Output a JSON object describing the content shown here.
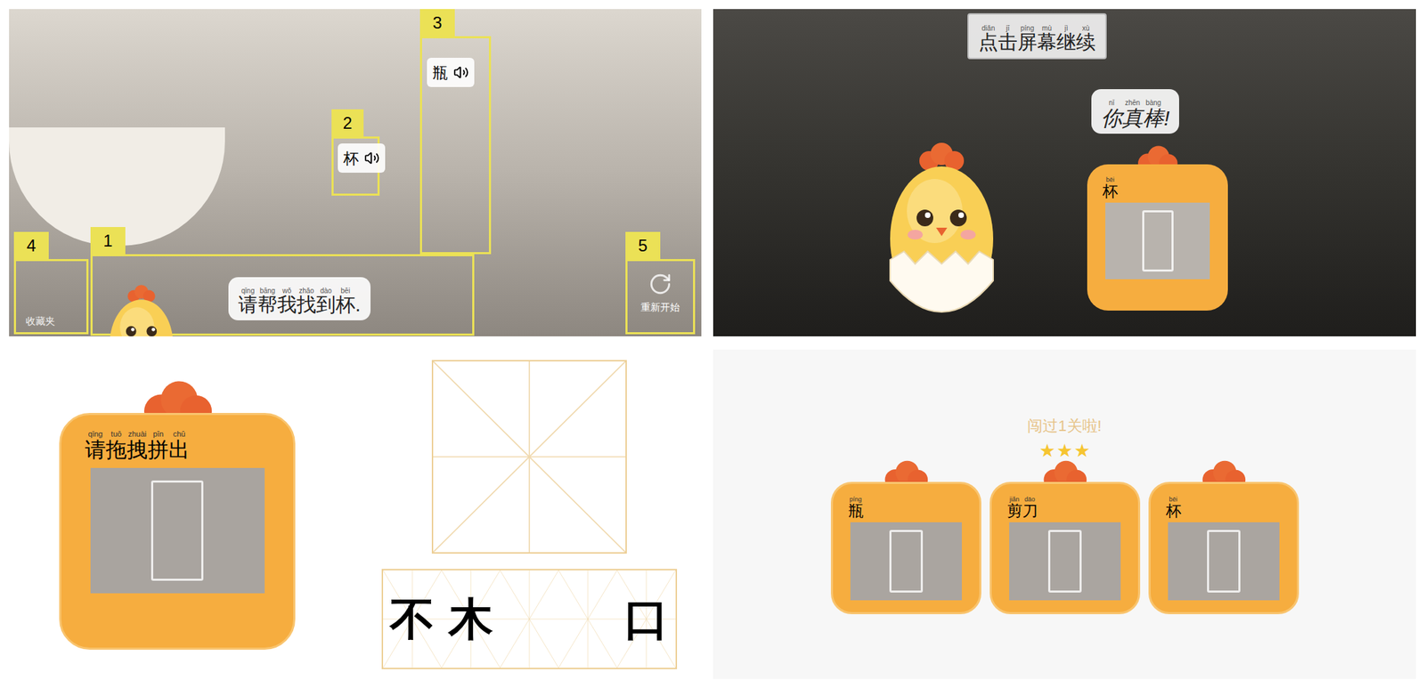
{
  "find_screen": {
    "annotations": [
      {
        "number": "1"
      },
      {
        "number": "2"
      },
      {
        "number": "3"
      },
      {
        "number": "4"
      },
      {
        "number": "5"
      }
    ],
    "labels": [
      {
        "text": "杯"
      },
      {
        "text": "瓶"
      }
    ],
    "prompt": {
      "text": "请帮我找到杯.",
      "pinyin": "qǐng bāng wǒ zhǎo dào bēi"
    },
    "close_button": "收藏夹",
    "restart_button": "重新开始"
  },
  "success_screen": {
    "hint": {
      "text": "点击屏幕继续",
      "pinyin": "diǎn jī píng mù jì xù"
    },
    "praise": {
      "text": "你真棒!",
      "pinyin": "nǐ zhēn bàng"
    },
    "card": {
      "text": "杯",
      "pinyin": "bēi"
    }
  },
  "spelling_screen": {
    "card": {
      "text": "请拖拽拼出",
      "pinyin": "qǐng tuō zhuài pīn chū"
    },
    "pieces": [
      "不",
      "木",
      "",
      "",
      "口"
    ]
  },
  "result_screen": {
    "title": "闯过1关啦!",
    "stars": 3,
    "cards": [
      {
        "text": "瓶",
        "pinyin": "píng"
      },
      {
        "text": "剪刀",
        "pinyin": "jiǎn dāo"
      },
      {
        "text": "杯",
        "pinyin": "bēi"
      }
    ]
  }
}
